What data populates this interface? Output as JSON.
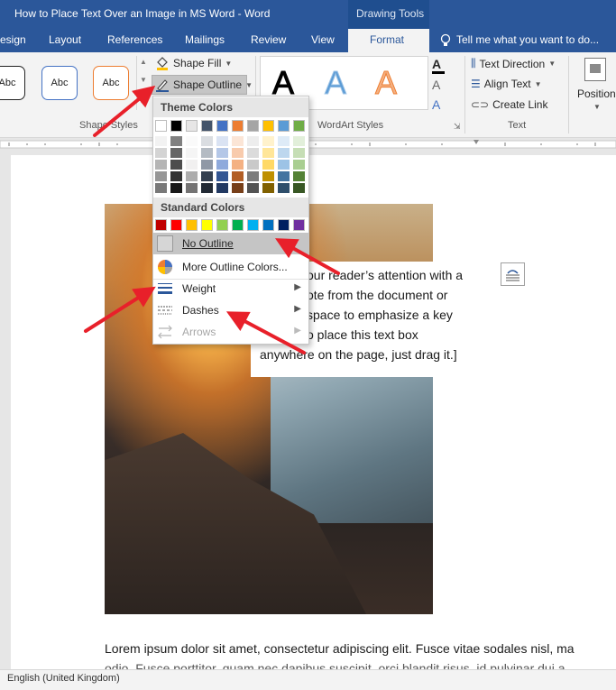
{
  "window": {
    "title": "How to Place Text Over an Image in MS Word - Word",
    "context_tab_group": "Drawing Tools"
  },
  "tabs": [
    "esign",
    "Layout",
    "References",
    "Mailings",
    "Review",
    "View"
  ],
  "active_tab": "Format",
  "tell_me": "Tell me what you want to do...",
  "ribbon": {
    "shape_samples": [
      "Abc",
      "Abc",
      "Abc"
    ],
    "shape_styles_label": "Shape Styles",
    "shape_fill": "Shape Fill",
    "shape_outline": "Shape Outline",
    "wordart_samples": [
      "A",
      "A",
      "A"
    ],
    "wordart_label": "WordArt Styles",
    "text_direction": "Text Direction",
    "align_text": "Align Text",
    "create_link": "Create Link",
    "text_label": "Text",
    "position": "Position"
  },
  "dropdown": {
    "theme_colors_label": "Theme Colors",
    "standard_colors_label": "Standard Colors",
    "theme_top": [
      "#ffffff",
      "#000000",
      "#e7e6e6",
      "#44546a",
      "#4472c4",
      "#ed7d31",
      "#a5a5a5",
      "#ffc000",
      "#5b9bd5",
      "#70ad47"
    ],
    "standard": [
      "#c00000",
      "#ff0000",
      "#ffc000",
      "#ffff00",
      "#92d050",
      "#00b050",
      "#00b0f0",
      "#0070c0",
      "#002060",
      "#7030a0"
    ],
    "items": {
      "no_outline": "No Outline",
      "more_colors": "More Outline Colors...",
      "weight": "Weight",
      "dashes": "Dashes",
      "arrows": "Arrows"
    }
  },
  "document": {
    "textbox_lines": [
      "our reader’s attention with a",
      "ote from the document or",
      "space to emphasize a key",
      "o place this text box",
      "anywhere on the page, just drag it.]"
    ],
    "body_line": "Lorem ipsum dolor sit amet, consectetur adipiscing elit. Fusce vitae sodales nisl, ma",
    "body_line2": "odio. Fusce porttitor, quam nec dapibus suscipit, orci blandit risus, id pulvinar dui a"
  },
  "status": {
    "language": "English (United Kingdom)"
  },
  "colors": {
    "accent": "#2b579a",
    "annotation": "#e8202a"
  }
}
